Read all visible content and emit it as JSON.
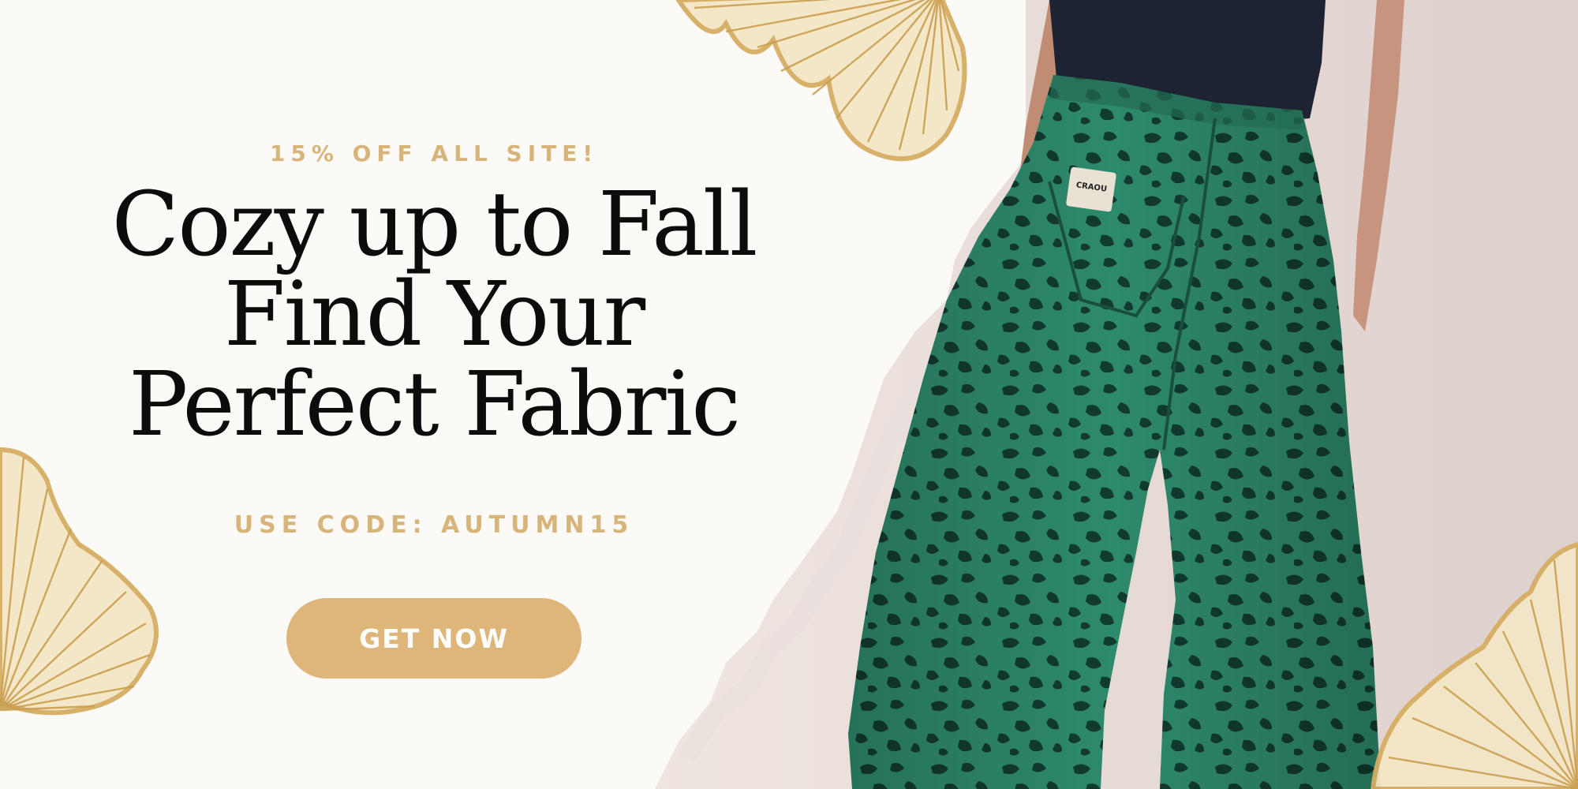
{
  "banner": {
    "promo": "15% OFF ALL SITE!",
    "headline": [
      "Cozy up to Fall",
      "Find Your",
      "Perfect Fabric"
    ],
    "code_line": "USE CODE: AUTUMN15",
    "cta_label": "GET NOW",
    "tag_text": "CRAOU"
  },
  "colors": {
    "background": "#fcfaf7",
    "gold": "#d7b47a",
    "button": "#deb67a",
    "pants_green": "#2e8a6c",
    "spots": "#123b30",
    "shirt": "#1d2333",
    "wall": "#e6dad6"
  },
  "decor": {
    "leaf": "ginkgo-leaf-icon"
  }
}
